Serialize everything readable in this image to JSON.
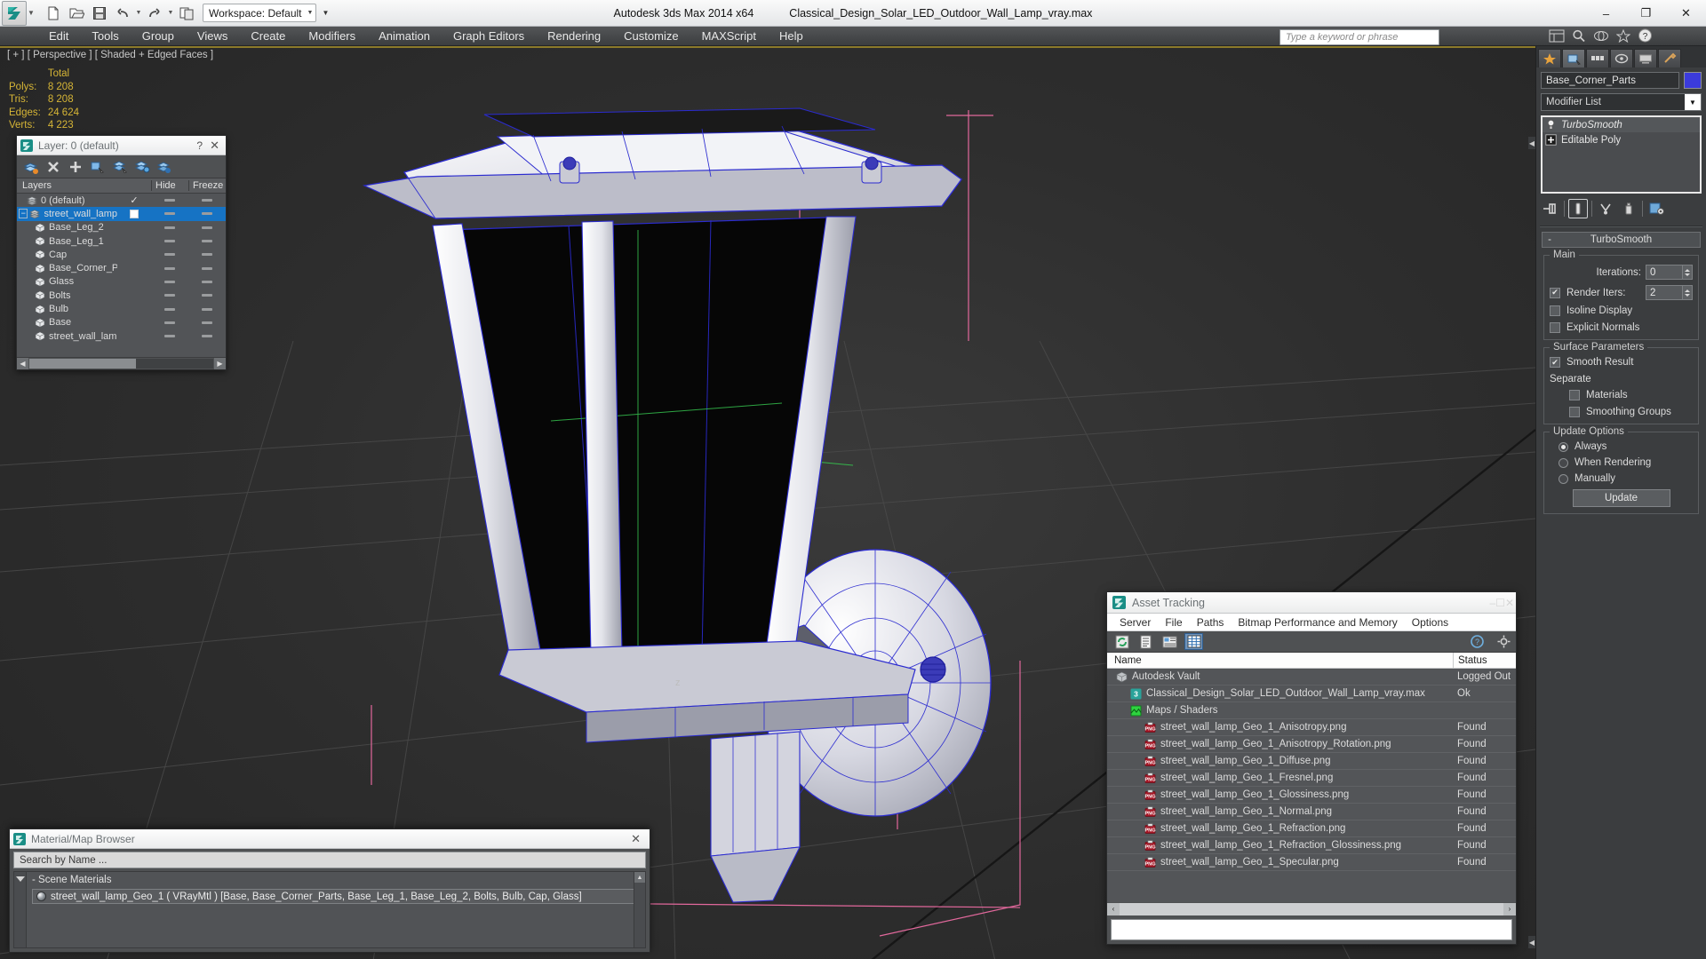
{
  "titlebar": {
    "workspace": "Workspace: Default",
    "app_title": "Autodesk 3ds Max  2014 x64",
    "file_title": "Classical_Design_Solar_LED_Outdoor_Wall_Lamp_vray.max",
    "minimize": "–",
    "maximize": "❐",
    "close": "✕",
    "quick_access": [
      {
        "name": "new-file-icon",
        "label": "New"
      },
      {
        "name": "open-file-icon",
        "label": "Open"
      },
      {
        "name": "save-file-icon",
        "label": "Save"
      },
      {
        "name": "undo-icon",
        "label": "Undo"
      },
      {
        "name": "redo-icon",
        "label": "Redo"
      },
      {
        "name": "project-folder-icon",
        "label": "Set Project Folder"
      }
    ]
  },
  "menubar": {
    "items": [
      "Edit",
      "Tools",
      "Group",
      "Views",
      "Create",
      "Modifiers",
      "Animation",
      "Graph Editors",
      "Rendering",
      "Customize",
      "MAXScript",
      "Help"
    ],
    "search_placeholder": "Type a keyword or phrase"
  },
  "viewport": {
    "label": "[ + ] [ Perspective ] [ Shaded + Edged Faces ]",
    "stats": {
      "header": "Total",
      "rows": [
        {
          "label": "Polys:",
          "value": "8 208"
        },
        {
          "label": "Tris:",
          "value": "8 208"
        },
        {
          "label": "Edges:",
          "value": "24 624"
        },
        {
          "label": "Verts:",
          "value": "4 223"
        }
      ]
    }
  },
  "layer_dialog": {
    "title": "Layer: 0 (default)",
    "help": "?",
    "close": "✕",
    "toolbar": [
      {
        "name": "create-new-layer-icon"
      },
      {
        "name": "delete-layer-icon"
      },
      {
        "name": "add-selection-to-layer-icon"
      },
      {
        "name": "select-objects-in-layer-icon"
      },
      {
        "name": "select-highlighted-objects-icon"
      },
      {
        "name": "highlight-selected-objects-layer-icon"
      },
      {
        "name": "hide-unhide-layer-icon"
      }
    ],
    "columns": [
      "Layers",
      "",
      "Hide",
      "Freeze"
    ],
    "rows": [
      {
        "name": "0 (default)",
        "indent": 1,
        "type": "layer",
        "selected": false,
        "expander": false,
        "current": "check"
      },
      {
        "name": "street_wall_lamp",
        "indent": 0,
        "type": "layer",
        "selected": true,
        "expander": true,
        "current": "box"
      },
      {
        "name": "Base_Leg_2",
        "indent": 2,
        "type": "object",
        "selected": false,
        "expander": false,
        "current": ""
      },
      {
        "name": "Base_Leg_1",
        "indent": 2,
        "type": "object",
        "selected": false,
        "expander": false,
        "current": ""
      },
      {
        "name": "Cap",
        "indent": 2,
        "type": "object",
        "selected": false,
        "expander": false,
        "current": ""
      },
      {
        "name": "Base_Corner_Parts",
        "indent": 2,
        "type": "object",
        "selected": false,
        "expander": false,
        "current": ""
      },
      {
        "name": "Glass",
        "indent": 2,
        "type": "object",
        "selected": false,
        "expander": false,
        "current": ""
      },
      {
        "name": "Bolts",
        "indent": 2,
        "type": "object",
        "selected": false,
        "expander": false,
        "current": ""
      },
      {
        "name": "Bulb",
        "indent": 2,
        "type": "object",
        "selected": false,
        "expander": false,
        "current": ""
      },
      {
        "name": "Base",
        "indent": 2,
        "type": "object",
        "selected": false,
        "expander": false,
        "current": ""
      },
      {
        "name": "street_wall_lamp",
        "indent": 2,
        "type": "object",
        "selected": false,
        "expander": false,
        "current": ""
      }
    ]
  },
  "material_browser": {
    "title": "Material/Map Browser",
    "close": "✕",
    "search_value": "Search by Name ...",
    "group_label": "- Scene Materials",
    "material": "street_wall_lamp_Geo_1  ( VRayMtl )  [Base, Base_Corner_Parts, Base_Leg_1, Base_Leg_2, Bolts, Bulb, Cap, Glass]"
  },
  "asset_tracking": {
    "title": "Asset Tracking",
    "minimize": "–",
    "maximize": "☐",
    "close": "✕",
    "menu": [
      "Server",
      "File",
      "Paths",
      "Bitmap Performance and Memory",
      "Options"
    ],
    "toolbar": [
      {
        "name": "refresh-icon"
      },
      {
        "name": "list-view-icon"
      },
      {
        "name": "detail-view-icon"
      },
      {
        "name": "grid-view-icon"
      }
    ],
    "toolbar_right": [
      {
        "name": "help-icon"
      },
      {
        "name": "settings-icon"
      }
    ],
    "columns": {
      "name": "Name",
      "status": "Status"
    },
    "rows": [
      {
        "name": "Autodesk Vault",
        "status": "Logged Out",
        "indent": 1,
        "icon": "vault-icon"
      },
      {
        "name": "Classical_Design_Solar_LED_Outdoor_Wall_Lamp_vray.max",
        "status": "Ok",
        "indent": 2,
        "icon": "max-file-icon"
      },
      {
        "name": "Maps / Shaders",
        "status": "",
        "indent": 2,
        "icon": "maps-shaders-icon"
      },
      {
        "name": "street_wall_lamp_Geo_1_Anisotropy.png",
        "status": "Found",
        "indent": 3,
        "icon": "png-icon"
      },
      {
        "name": "street_wall_lamp_Geo_1_Anisotropy_Rotation.png",
        "status": "Found",
        "indent": 3,
        "icon": "png-icon"
      },
      {
        "name": "street_wall_lamp_Geo_1_Diffuse.png",
        "status": "Found",
        "indent": 3,
        "icon": "png-icon"
      },
      {
        "name": "street_wall_lamp_Geo_1_Fresnel.png",
        "status": "Found",
        "indent": 3,
        "icon": "png-icon"
      },
      {
        "name": "street_wall_lamp_Geo_1_Glossiness.png",
        "status": "Found",
        "indent": 3,
        "icon": "png-icon"
      },
      {
        "name": "street_wall_lamp_Geo_1_Normal.png",
        "status": "Found",
        "indent": 3,
        "icon": "png-icon"
      },
      {
        "name": "street_wall_lamp_Geo_1_Refraction.png",
        "status": "Found",
        "indent": 3,
        "icon": "png-icon"
      },
      {
        "name": "street_wall_lamp_Geo_1_Refraction_Glossiness.png",
        "status": "Found",
        "indent": 3,
        "icon": "png-icon"
      },
      {
        "name": "street_wall_lamp_Geo_1_Specular.png",
        "status": "Found",
        "indent": 3,
        "icon": "png-icon"
      }
    ],
    "scroll_left": "‹",
    "scroll_right": "›"
  },
  "command_panel": {
    "tabs": [
      {
        "name": "create-tab",
        "icon": "star-icon",
        "active": false
      },
      {
        "name": "modify-tab",
        "icon": "modify-icon",
        "active": true
      },
      {
        "name": "hierarchy-tab",
        "icon": "hierarchy-icon",
        "active": false
      },
      {
        "name": "motion-tab",
        "icon": "motion-icon",
        "active": false
      },
      {
        "name": "display-tab",
        "icon": "display-icon",
        "active": false
      },
      {
        "name": "utilities-tab",
        "icon": "utilities-icon",
        "active": false
      }
    ],
    "object_name": "Base_Corner_Parts",
    "object_color": "#3b3bdc",
    "modifier_list_label": "Modifier List",
    "stack": [
      {
        "name": "TurboSmooth",
        "italic": true,
        "icon": "lightbulb-icon",
        "expander": false
      },
      {
        "name": "Editable Poly",
        "italic": false,
        "icon": "plus-box-icon",
        "expander": true
      }
    ],
    "stack_tools": [
      {
        "name": "pin-stack-icon"
      },
      {
        "name": "show-end-result-icon"
      },
      {
        "name": "make-unique-icon"
      },
      {
        "name": "remove-modifier-icon"
      },
      {
        "name": "configure-modifier-sets-icon"
      }
    ],
    "rollout": {
      "title": "TurboSmooth",
      "collapse_sign": "-",
      "main": {
        "group_label": "Main",
        "iterations_label": "Iterations:",
        "iterations_value": "0",
        "render_iters_label": "Render Iters:",
        "render_iters_value": "2",
        "render_iters_checked": true,
        "isoline_label": "Isoline Display",
        "isoline_checked": false,
        "explicit_label": "Explicit Normals",
        "explicit_checked": false
      },
      "surface": {
        "group_label": "Surface Parameters",
        "smooth_result_label": "Smooth Result",
        "smooth_result_checked": true,
        "separate_label": "Separate",
        "materials_label": "Materials",
        "materials_checked": false,
        "smoothing_groups_label": "Smoothing Groups",
        "smoothing_groups_checked": false
      },
      "update": {
        "group_label": "Update Options",
        "always_label": "Always",
        "when_rendering_label": "When Rendering",
        "manually_label": "Manually",
        "selected": "Always",
        "button_label": "Update"
      }
    }
  }
}
